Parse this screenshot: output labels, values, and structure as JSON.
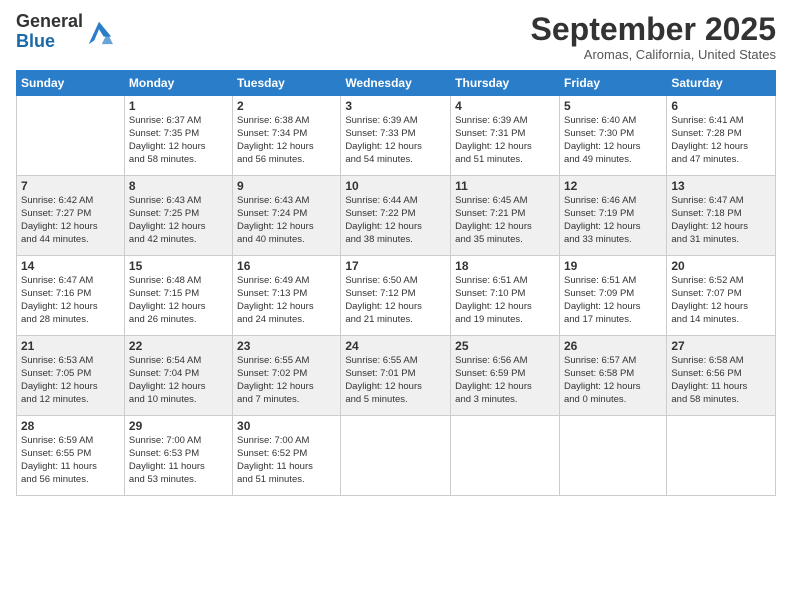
{
  "header": {
    "logo_line1": "General",
    "logo_line2": "Blue",
    "month": "September 2025",
    "location": "Aromas, California, United States"
  },
  "days_of_week": [
    "Sunday",
    "Monday",
    "Tuesday",
    "Wednesday",
    "Thursday",
    "Friday",
    "Saturday"
  ],
  "weeks": [
    [
      {
        "num": "",
        "info": ""
      },
      {
        "num": "1",
        "info": "Sunrise: 6:37 AM\nSunset: 7:35 PM\nDaylight: 12 hours\nand 58 minutes."
      },
      {
        "num": "2",
        "info": "Sunrise: 6:38 AM\nSunset: 7:34 PM\nDaylight: 12 hours\nand 56 minutes."
      },
      {
        "num": "3",
        "info": "Sunrise: 6:39 AM\nSunset: 7:33 PM\nDaylight: 12 hours\nand 54 minutes."
      },
      {
        "num": "4",
        "info": "Sunrise: 6:39 AM\nSunset: 7:31 PM\nDaylight: 12 hours\nand 51 minutes."
      },
      {
        "num": "5",
        "info": "Sunrise: 6:40 AM\nSunset: 7:30 PM\nDaylight: 12 hours\nand 49 minutes."
      },
      {
        "num": "6",
        "info": "Sunrise: 6:41 AM\nSunset: 7:28 PM\nDaylight: 12 hours\nand 47 minutes."
      }
    ],
    [
      {
        "num": "7",
        "info": "Sunrise: 6:42 AM\nSunset: 7:27 PM\nDaylight: 12 hours\nand 44 minutes."
      },
      {
        "num": "8",
        "info": "Sunrise: 6:43 AM\nSunset: 7:25 PM\nDaylight: 12 hours\nand 42 minutes."
      },
      {
        "num": "9",
        "info": "Sunrise: 6:43 AM\nSunset: 7:24 PM\nDaylight: 12 hours\nand 40 minutes."
      },
      {
        "num": "10",
        "info": "Sunrise: 6:44 AM\nSunset: 7:22 PM\nDaylight: 12 hours\nand 38 minutes."
      },
      {
        "num": "11",
        "info": "Sunrise: 6:45 AM\nSunset: 7:21 PM\nDaylight: 12 hours\nand 35 minutes."
      },
      {
        "num": "12",
        "info": "Sunrise: 6:46 AM\nSunset: 7:19 PM\nDaylight: 12 hours\nand 33 minutes."
      },
      {
        "num": "13",
        "info": "Sunrise: 6:47 AM\nSunset: 7:18 PM\nDaylight: 12 hours\nand 31 minutes."
      }
    ],
    [
      {
        "num": "14",
        "info": "Sunrise: 6:47 AM\nSunset: 7:16 PM\nDaylight: 12 hours\nand 28 minutes."
      },
      {
        "num": "15",
        "info": "Sunrise: 6:48 AM\nSunset: 7:15 PM\nDaylight: 12 hours\nand 26 minutes."
      },
      {
        "num": "16",
        "info": "Sunrise: 6:49 AM\nSunset: 7:13 PM\nDaylight: 12 hours\nand 24 minutes."
      },
      {
        "num": "17",
        "info": "Sunrise: 6:50 AM\nSunset: 7:12 PM\nDaylight: 12 hours\nand 21 minutes."
      },
      {
        "num": "18",
        "info": "Sunrise: 6:51 AM\nSunset: 7:10 PM\nDaylight: 12 hours\nand 19 minutes."
      },
      {
        "num": "19",
        "info": "Sunrise: 6:51 AM\nSunset: 7:09 PM\nDaylight: 12 hours\nand 17 minutes."
      },
      {
        "num": "20",
        "info": "Sunrise: 6:52 AM\nSunset: 7:07 PM\nDaylight: 12 hours\nand 14 minutes."
      }
    ],
    [
      {
        "num": "21",
        "info": "Sunrise: 6:53 AM\nSunset: 7:05 PM\nDaylight: 12 hours\nand 12 minutes."
      },
      {
        "num": "22",
        "info": "Sunrise: 6:54 AM\nSunset: 7:04 PM\nDaylight: 12 hours\nand 10 minutes."
      },
      {
        "num": "23",
        "info": "Sunrise: 6:55 AM\nSunset: 7:02 PM\nDaylight: 12 hours\nand 7 minutes."
      },
      {
        "num": "24",
        "info": "Sunrise: 6:55 AM\nSunset: 7:01 PM\nDaylight: 12 hours\nand 5 minutes."
      },
      {
        "num": "25",
        "info": "Sunrise: 6:56 AM\nSunset: 6:59 PM\nDaylight: 12 hours\nand 3 minutes."
      },
      {
        "num": "26",
        "info": "Sunrise: 6:57 AM\nSunset: 6:58 PM\nDaylight: 12 hours\nand 0 minutes."
      },
      {
        "num": "27",
        "info": "Sunrise: 6:58 AM\nSunset: 6:56 PM\nDaylight: 11 hours\nand 58 minutes."
      }
    ],
    [
      {
        "num": "28",
        "info": "Sunrise: 6:59 AM\nSunset: 6:55 PM\nDaylight: 11 hours\nand 56 minutes."
      },
      {
        "num": "29",
        "info": "Sunrise: 7:00 AM\nSunset: 6:53 PM\nDaylight: 11 hours\nand 53 minutes."
      },
      {
        "num": "30",
        "info": "Sunrise: 7:00 AM\nSunset: 6:52 PM\nDaylight: 11 hours\nand 51 minutes."
      },
      {
        "num": "",
        "info": ""
      },
      {
        "num": "",
        "info": ""
      },
      {
        "num": "",
        "info": ""
      },
      {
        "num": "",
        "info": ""
      }
    ]
  ]
}
